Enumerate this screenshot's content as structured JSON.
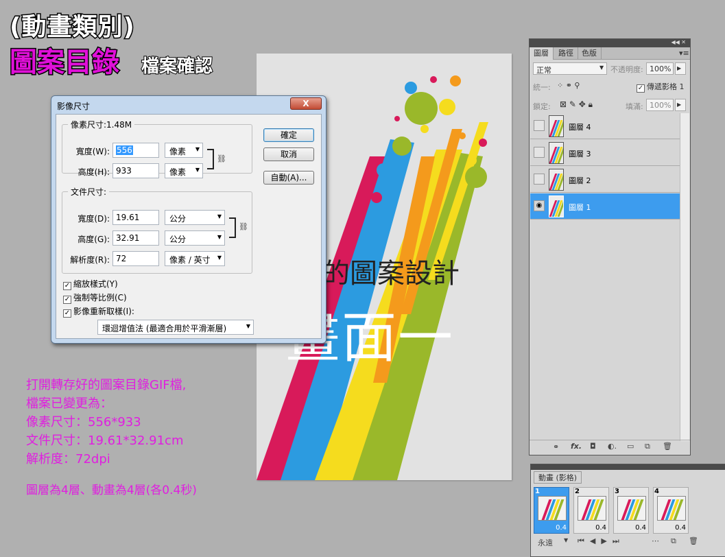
{
  "heading": {
    "line1": "(動畫類別)",
    "line2": "圖案目錄",
    "line2_sub": "檔案確認"
  },
  "notes": {
    "lines": [
      "打開轉存好的圖案目錄GIF檔,",
      "檔案已變更為：",
      "像素尺寸：556*933",
      "文件尺寸：19.61*32.91cm",
      "解析度：72dpi"
    ],
    "last": "圖層為4層、動畫為4層(各0.4秒)"
  },
  "poster": {
    "title": "的圖案設計",
    "big": "畫面一",
    "colors": [
      "#d81a5a",
      "#2c9be0",
      "#f5dc1e",
      "#9ab82a",
      "#f49a1c",
      "#e83a2e"
    ]
  },
  "dialog": {
    "title": "影像尺寸",
    "close": "X",
    "pixel_legend": "像素尺寸:1.48M",
    "width_label": "寬度(W):",
    "width_value": "556",
    "width_unit": "像素",
    "height_label": "高度(H):",
    "height_value": "933",
    "height_unit": "像素",
    "doc_legend": "文件尺寸:",
    "doc_width_label": "寬度(D):",
    "doc_width_value": "19.61",
    "doc_width_unit": "公分",
    "doc_height_label": "高度(G):",
    "doc_height_value": "32.91",
    "doc_height_unit": "公分",
    "res_label": "解析度(R):",
    "res_value": "72",
    "res_unit": "像素 / 英寸",
    "chk_scale": "縮放樣式(Y)",
    "chk_constrain": "強制等比例(C)",
    "chk_resample": "影像重新取樣(I):",
    "resample_method": "環迴增值法 (最適合用於平滑漸層)",
    "ok": "確定",
    "cancel": "取消",
    "auto": "自動(A)..."
  },
  "layers_panel": {
    "tabs": [
      "圖層",
      "路徑",
      "色版"
    ],
    "blend_mode": "正常",
    "opacity_label": "不透明度:",
    "opacity_value": "100%",
    "unify_label": "統一:",
    "propagate_label": "傳遞影格 1",
    "lock_label": "鎖定:",
    "fill_label": "填滿:",
    "fill_value": "100%",
    "layers": [
      {
        "name": "圖層 4",
        "visible": false,
        "selected": false
      },
      {
        "name": "圖層 3",
        "visible": false,
        "selected": false
      },
      {
        "name": "圖層 2",
        "visible": false,
        "selected": false
      },
      {
        "name": "圖層 1",
        "visible": true,
        "selected": true
      }
    ],
    "footer_icons": [
      "link-icon",
      "fx-icon",
      "mask-icon",
      "adjustment-icon",
      "folder-icon",
      "new-layer-icon",
      "trash-icon"
    ]
  },
  "animation_panel": {
    "tab": "動畫 (影格)",
    "frames": [
      {
        "num": "1",
        "time": "0.4"
      },
      {
        "num": "2",
        "time": "0.4"
      },
      {
        "num": "3",
        "time": "0.4"
      },
      {
        "num": "4",
        "time": "0.4"
      }
    ],
    "loop": "永遠"
  }
}
